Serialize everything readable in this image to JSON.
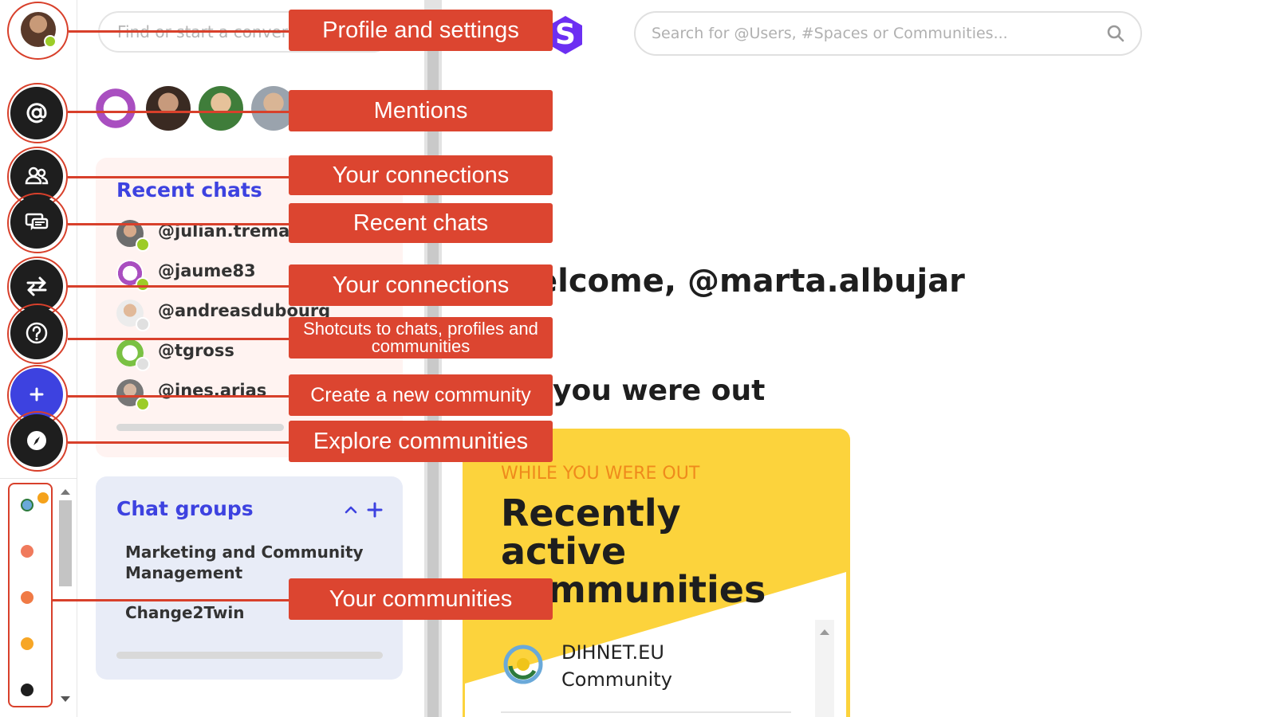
{
  "chat_panel": {
    "search_placeholder": "Find or start a conversation",
    "recent_title": "Recent chats",
    "recent": [
      {
        "handle": "@julian.tremaud",
        "status": "online"
      },
      {
        "handle": "@jaume83",
        "status": "online"
      },
      {
        "handle": "@andreasdubourg",
        "status": "offline"
      },
      {
        "handle": "@tgross",
        "status": "offline"
      },
      {
        "handle": "@ines.arias",
        "status": "online"
      }
    ],
    "groups_title": "Chat groups",
    "groups_collapse_icon": "chevron-up-icon",
    "groups_add_icon": "plus-icon",
    "groups": [
      "Marketing and Community Management",
      "Change2Twin"
    ]
  },
  "header": {
    "logo_letter": "S",
    "search_placeholder": "Search for @Users, #Spaces or Communities..."
  },
  "main": {
    "welcome": "elcome, @marta.albujar",
    "section_heading": "you were out",
    "card": {
      "kicker": "WHILE YOU WERE OUT",
      "title": "Recently active communities",
      "community_name": "DIHNET.EU Community"
    }
  },
  "rail": {
    "icons": [
      "profile-avatar",
      "at-icon",
      "connections-icon",
      "chat-icon",
      "switch-icon",
      "help-icon",
      "plus-icon",
      "compass-icon"
    ],
    "status_color": "#9ccc28"
  },
  "annotations": [
    "Profile and settings",
    "Mentions",
    "Your connections",
    "Recent chats",
    "Your connections",
    "Shotcuts to chats, profiles and communities",
    "Create a new community",
    "Explore communities",
    "Your communities"
  ],
  "colors": {
    "accent": "#3d42e0",
    "callout": "#dc4530",
    "card_yellow": "#fcd33c",
    "kicker_orange": "#ef8a1c",
    "brand_purple": "#6c2ff2"
  }
}
